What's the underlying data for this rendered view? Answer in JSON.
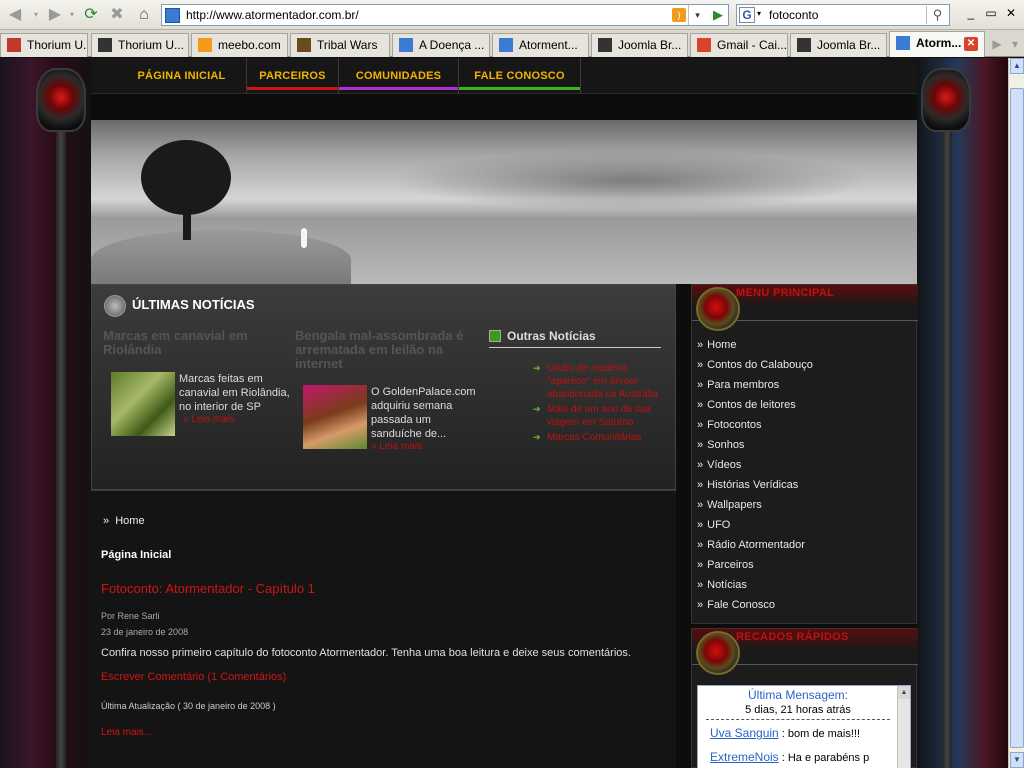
{
  "browser": {
    "url": "http://www.atormentador.com.br/",
    "search_text": "fotoconto",
    "search_engine_icon": "G",
    "window_controls": [
      "_",
      "▭",
      "✕"
    ],
    "tabs": [
      {
        "label": "Thorium U...",
        "icon": "puzzle-icon",
        "color": "#c0392b"
      },
      {
        "label": "Thorium U...",
        "icon": "joomla-icon",
        "color": "#333"
      },
      {
        "label": "meebo.com",
        "icon": "meebo-icon",
        "color": "#f39a1d"
      },
      {
        "label": "Tribal Wars",
        "icon": "tribal-icon",
        "color": "#6b4a1e"
      },
      {
        "label": "A Doença ...",
        "icon": "document-icon",
        "color": "#3a7bd5"
      },
      {
        "label": "Atorment...",
        "icon": "site-icon",
        "color": "#3a7bd5"
      },
      {
        "label": "Joomla Br...",
        "icon": "joomla-icon",
        "color": "#333"
      },
      {
        "label": "Gmail - Cai...",
        "icon": "gmail-icon",
        "color": "#d9422b"
      },
      {
        "label": "Joomla Br...",
        "icon": "joomla-icon",
        "color": "#333"
      },
      {
        "label": "Atorm...",
        "icon": "site-icon",
        "color": "#3a7bd5",
        "active": true
      }
    ]
  },
  "site": {
    "nav": [
      {
        "label": "PÁGINA INICIAL",
        "color": ""
      },
      {
        "label": "PARCEIROS",
        "color": "#d01414"
      },
      {
        "label": "COMUNIDADES",
        "color": "#b12ed6"
      },
      {
        "label": "FALE CONOSCO",
        "color": "#3ab51a"
      }
    ],
    "news": {
      "heading": "ÚLTIMAS NOTÍCIAS",
      "items": [
        {
          "title": "Marcas em canavial em Riolândia",
          "desc": "Marcas feitas em canavial em Riolândia, no interior de SP",
          "more": "» Leia mais"
        },
        {
          "title": "Bengala mal-assombrada é arrematada em leilão na internet",
          "desc": "O GoldenPalace.com adquiriu semana passada um sanduíche de...",
          "more": "» Leia mais"
        }
      ],
      "others_heading": "Outras Notícias",
      "others": [
        "Urubu de madeira \"aparece\" em árvore abandonada na Austrália",
        "Mais de um ano da sua viagem em Saturno",
        "Marcas Comunitárias"
      ]
    },
    "content": {
      "breadcrumb": "Home",
      "page_title": "Página Inicial",
      "article_title": "Fotoconto: Atormentador - Capítulo 1",
      "author": "Por Rene Sarli",
      "date": "23 de janeiro de 2008",
      "body": "Confira nosso primeiro capítulo do fotoconto Atormentador. Tenha uma boa leitura e deixe seus comentários.",
      "comments": "Escrever Comentário (1 Comentários)",
      "updated": "Última Atualização ( 30 de janeiro de 2008 )",
      "read_more": "Leia mais..."
    },
    "sidebar": {
      "menu_title": "MENU PRINCIPAL",
      "menu": [
        "Home",
        "Contos do Calabouço",
        "Para membros",
        "Contos de leitores",
        "Fotocontos",
        "Sonhos",
        "Vídeos",
        "Histórias Verídicas",
        "Wallpapers",
        "UFO",
        "Rádio Atormentador",
        "Parceiros",
        "Notícias",
        "Fale Conosco"
      ],
      "recados_title": "RECADOS RÁPIDOS",
      "shout": {
        "last_label": "Última Mensagem:",
        "ago": "5 dias, 21 horas atrás",
        "messages": [
          {
            "user": "Uva Sanguin",
            "text": ": bom de mais!!!"
          },
          {
            "user": "ExtremeNois",
            "text": ": Ha e parabéns p"
          }
        ]
      }
    }
  }
}
